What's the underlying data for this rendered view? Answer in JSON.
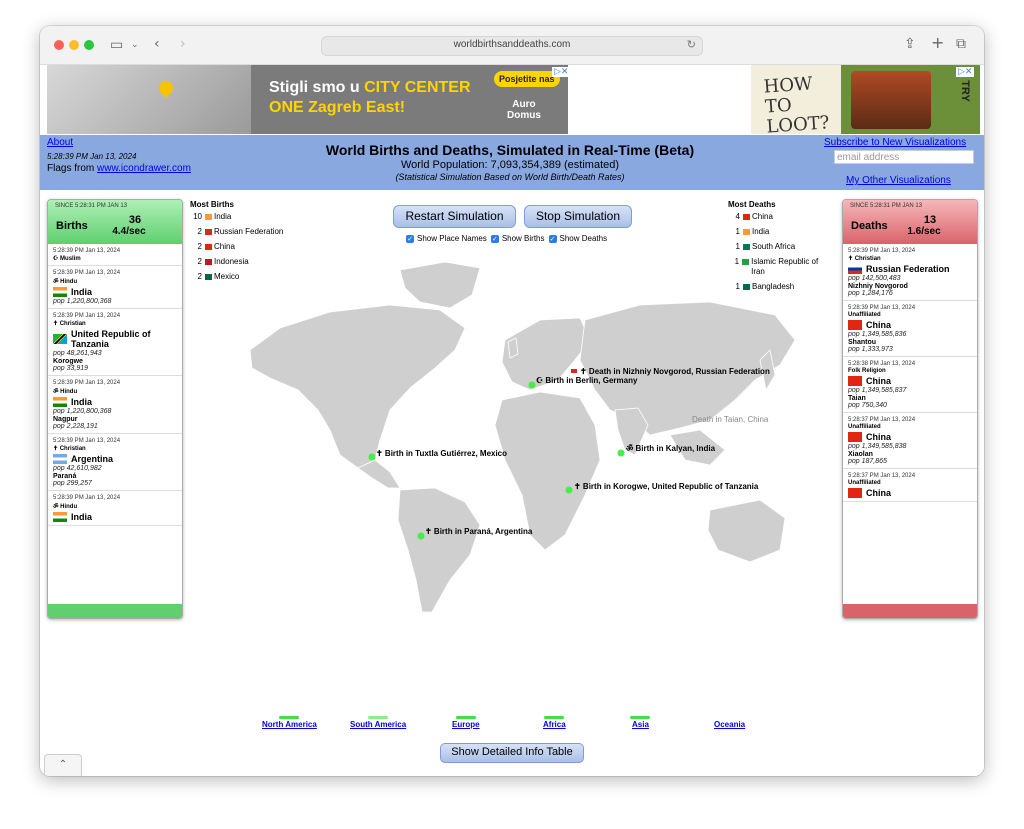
{
  "browser": {
    "url": "worldbirthsanddeaths.com"
  },
  "ads": {
    "ad1": {
      "line1_a": "Stigli smo u ",
      "line1_b": "CITY CENTER",
      "line2": "ONE Zagreb East!",
      "cta": "Posjetite nas",
      "brand_1": "Auro",
      "brand_2": "Domus"
    },
    "ad2": {
      "line1": "HOW TO",
      "line2": "LOOT?",
      "try": "TRY"
    },
    "close": "▷✕"
  },
  "header": {
    "about": "About",
    "datetime": "5:28:39 PM Jan 13, 2024",
    "flags_prefix": "Flags from ",
    "flags_link": "www.icondrawer.com",
    "title": "World Births and Deaths, Simulated in Real-Time (Beta)",
    "population": "World Population: 7,093,354,389 (estimated)",
    "subtitle": "(Statistical Simulation Based on World Birth/Death Rates)",
    "subscribe": "Subscribe to New Visualizations",
    "email_placeholder": "email address",
    "other": "My Other Visualizations"
  },
  "births": {
    "since": "SINCE 5:28:31 PM JAN 13",
    "label": "Births",
    "count": "36",
    "rate": "4.4/sec",
    "entries": [
      {
        "time": "5:28:39 PM Jan 13, 2024",
        "religion": "☪ Muslim",
        "country": "",
        "pop": "",
        "city": "",
        "citypop": "",
        "flag": ""
      },
      {
        "time": "5:28:39 PM Jan 13, 2024",
        "religion": "ॐ Hindu",
        "country": "India",
        "pop": "pop 1,220,800,368",
        "city": "",
        "citypop": "",
        "flag": "india"
      },
      {
        "time": "5:28:39 PM Jan 13, 2024",
        "religion": "✝ Christian",
        "country": "United Republic of Tanzania",
        "pop": "pop 48,261,943",
        "city": "Korogwe",
        "citypop": "pop 33,919",
        "flag": "tanzania"
      },
      {
        "time": "5:28:39 PM Jan 13, 2024",
        "religion": "ॐ Hindu",
        "country": "India",
        "pop": "pop 1,220,800,368",
        "city": "Nagpur",
        "citypop": "pop 2,228,191",
        "flag": "india"
      },
      {
        "time": "5:28:39 PM Jan 13, 2024",
        "religion": "✝ Christian",
        "country": "Argentina",
        "pop": "pop 42,610,982",
        "city": "Paraná",
        "citypop": "pop 299,257",
        "flag": "argentina"
      },
      {
        "time": "5:28:39 PM Jan 13, 2024",
        "religion": "ॐ Hindu",
        "country": "India",
        "pop": "",
        "city": "",
        "citypop": "",
        "flag": "india"
      }
    ]
  },
  "deaths": {
    "since": "SINCE 5:28:31 PM JAN 13",
    "label": "Deaths",
    "count": "13",
    "rate": "1.6/sec",
    "entries": [
      {
        "time": "5:28:39 PM Jan 13, 2024",
        "religion": "✝ Christian",
        "country": "Russian Federation",
        "pop": "pop 142,500,483",
        "city": "Nizhniy Novgorod",
        "citypop": "pop 1,284,176",
        "flag": "russia"
      },
      {
        "time": "5:28:39 PM Jan 13, 2024",
        "religion": "Unaffiliated",
        "country": "China",
        "pop": "pop 1,349,585,836",
        "city": "Shantou",
        "citypop": "pop 1,333,973",
        "flag": "china"
      },
      {
        "time": "5:28:38 PM Jan 13, 2024",
        "religion": "Folk Religion",
        "country": "China",
        "pop": "pop 1,349,585,837",
        "city": "Taian",
        "citypop": "pop 750,340",
        "flag": "china"
      },
      {
        "time": "5:28:37 PM Jan 13, 2024",
        "religion": "Unaffiliated",
        "country": "China",
        "pop": "pop 1,349,585,838",
        "city": "Xiaolan",
        "citypop": "pop 187,865",
        "flag": "china"
      },
      {
        "time": "5:28:37 PM Jan 13, 2024",
        "religion": "Unaffiliated",
        "country": "China",
        "pop": "",
        "city": "",
        "citypop": "",
        "flag": "china"
      }
    ]
  },
  "most_births": {
    "title": "Most Births",
    "rows": [
      {
        "n": "10",
        "country": "India",
        "color": "#ff9933"
      },
      {
        "n": "2",
        "country": "Russian Federation",
        "color": "#d52b1e"
      },
      {
        "n": "2",
        "country": "China",
        "color": "#de2910"
      },
      {
        "n": "2",
        "country": "Indonesia",
        "color": "#ce1126"
      },
      {
        "n": "2",
        "country": "Mexico",
        "color": "#006847"
      }
    ]
  },
  "most_deaths": {
    "title": "Most Deaths",
    "rows": [
      {
        "n": "4",
        "country": "China",
        "color": "#de2910"
      },
      {
        "n": "1",
        "country": "India",
        "color": "#ff9933"
      },
      {
        "n": "1",
        "country": "South Africa",
        "color": "#007a4d"
      },
      {
        "n": "1",
        "country": "Islamic Republic of Iran",
        "color": "#239f40"
      },
      {
        "n": "1",
        "country": "Bangladesh",
        "color": "#006a4e"
      }
    ]
  },
  "controls": {
    "restart": "Restart Simulation",
    "stop": "Stop Simulation",
    "show_place_names": "Show Place Names",
    "show_births": "Show Births",
    "show_deaths": "Show Deaths"
  },
  "map_events": [
    {
      "text": "✝ Death in Nizhniy Novgorod, Russian Federation",
      "kind": "death"
    },
    {
      "text": "☪ Birth in Berlin, Germany",
      "kind": "birth"
    },
    {
      "text": "Death in Taian, China",
      "kind": "faded"
    },
    {
      "text": "ॐ Birth in Kalyan, India",
      "kind": "birth"
    },
    {
      "text": "✝ Birth in Tuxtla Gutiérrez, Mexico",
      "kind": "birth"
    },
    {
      "text": "✝ Birth in Korogwe, United Republic of Tanzania",
      "kind": "birth"
    },
    {
      "text": "✝ Birth in Paraná, Argentina",
      "kind": "birth"
    }
  ],
  "continents": [
    {
      "name": "North America",
      "bar": "#44dd44"
    },
    {
      "name": "South America",
      "bar": "#88ee88"
    },
    {
      "name": "Europe",
      "bar": "#44dd44"
    },
    {
      "name": "Africa",
      "bar": "#44dd44"
    },
    {
      "name": "Asia",
      "bar": "#44dd44"
    },
    {
      "name": "Oceania",
      "bar": ""
    }
  ],
  "detail_button": "Show Detailed Info Table",
  "colors": {
    "births_green": "#5fcf6f",
    "deaths_red": "#d9636a",
    "banner_blue": "#8aa8e0",
    "map_land": "#cfcfcf"
  }
}
